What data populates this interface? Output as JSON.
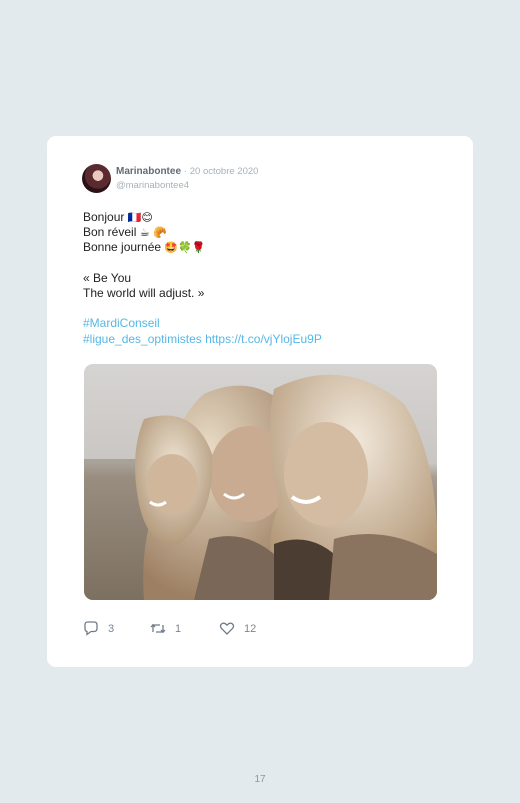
{
  "tweet": {
    "author_name": "Marinabontee",
    "separator": "·",
    "date": "20 octobre 2020",
    "handle": "@marinabontee4",
    "lines": [
      {
        "text": "Bonjour",
        "emoji": "🇫🇷😊"
      },
      {
        "text": "Bon réveil",
        "emoji": "☕ 🥐"
      },
      {
        "text": "Bonne journée",
        "emoji": "🤩🍀🌹"
      },
      {
        "text": "«  Be You"
      },
      {
        "text": "The world will adjust. »"
      }
    ],
    "hashtag_1": "#MardiConseil",
    "hashtag_2": "#ligue_des_optimistes",
    "url": "https://t.co/vjYlojEu9P",
    "photo_alt": "three laughing blonde girls"
  },
  "actions": {
    "replies": "3",
    "retweets": "1",
    "likes": "12",
    "reply_icon": "reply-icon",
    "retweet_icon": "retweet-icon",
    "like_icon": "heart-icon"
  },
  "page_number": "17",
  "colors": {
    "background": "#e3eaed",
    "card": "#ffffff",
    "link": "#56b7e6",
    "muted": "#a6b1ba"
  }
}
